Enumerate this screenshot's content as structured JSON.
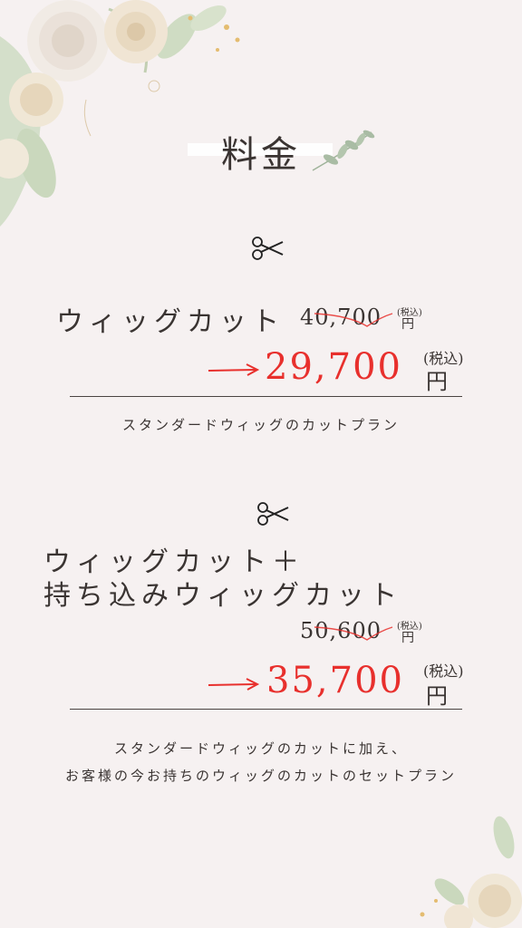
{
  "title": "料金",
  "plans": [
    {
      "name": "ウィッグカット",
      "old_price": "40,700",
      "old_tax": "(税込)",
      "old_yen": "円",
      "new_price": "29,700",
      "new_tax": "(税込)",
      "new_yen": "円",
      "description": "スタンダードウィッグのカットプラン"
    },
    {
      "name_line1": "ウィッグカット＋",
      "name_line2": "持ち込みウィッグカット",
      "old_price": "50,600",
      "old_tax": "(税込)",
      "old_yen": "円",
      "new_price": "35,700",
      "new_tax": "(税込)",
      "new_yen": "円",
      "description_line1": "スタンダードウィッグのカットに加え、",
      "description_line2": "お客様の今お持ちのウィッグのカットのセットプラン"
    }
  ],
  "colors": {
    "background": "#f6f1f1",
    "accent_red": "#e8302d",
    "text": "#3a3432"
  },
  "icons": [
    "floral-corner-decoration",
    "leaf-sprig-icon",
    "scissors-icon",
    "arrow-right-icon"
  ]
}
